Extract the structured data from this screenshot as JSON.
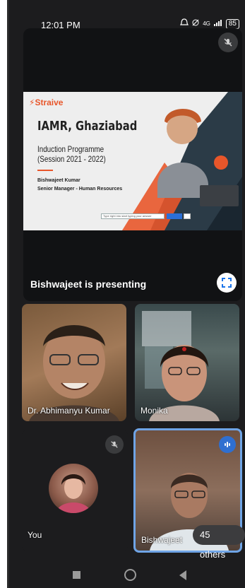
{
  "status_bar": {
    "time": "12:01 PM",
    "network": "4G",
    "battery": "85"
  },
  "presentation": {
    "presenter_label": "Bishwajeet is presenting",
    "slide": {
      "logo": "Straive",
      "title": "IAMR, Ghaziabad",
      "subtitle_line1": "Induction Programme",
      "subtitle_line2": "(Session 2021 - 2022)",
      "presenter_name": "Bishwajeet Kumar",
      "presenter_role": "Senior Manager - Human Resources",
      "search_placeholder": "Type right into start typing your answer"
    }
  },
  "participants": [
    {
      "name": "Dr. Abhimanyu Kumar"
    },
    {
      "name": "Monika"
    },
    {
      "name": "You"
    },
    {
      "name": "Bishwajeet"
    }
  ],
  "others_chip": "45 others",
  "colors": {
    "accent_orange": "#e8562a",
    "speaker_border": "#6fa4e6",
    "speaking_badge": "#2f6fd0"
  }
}
